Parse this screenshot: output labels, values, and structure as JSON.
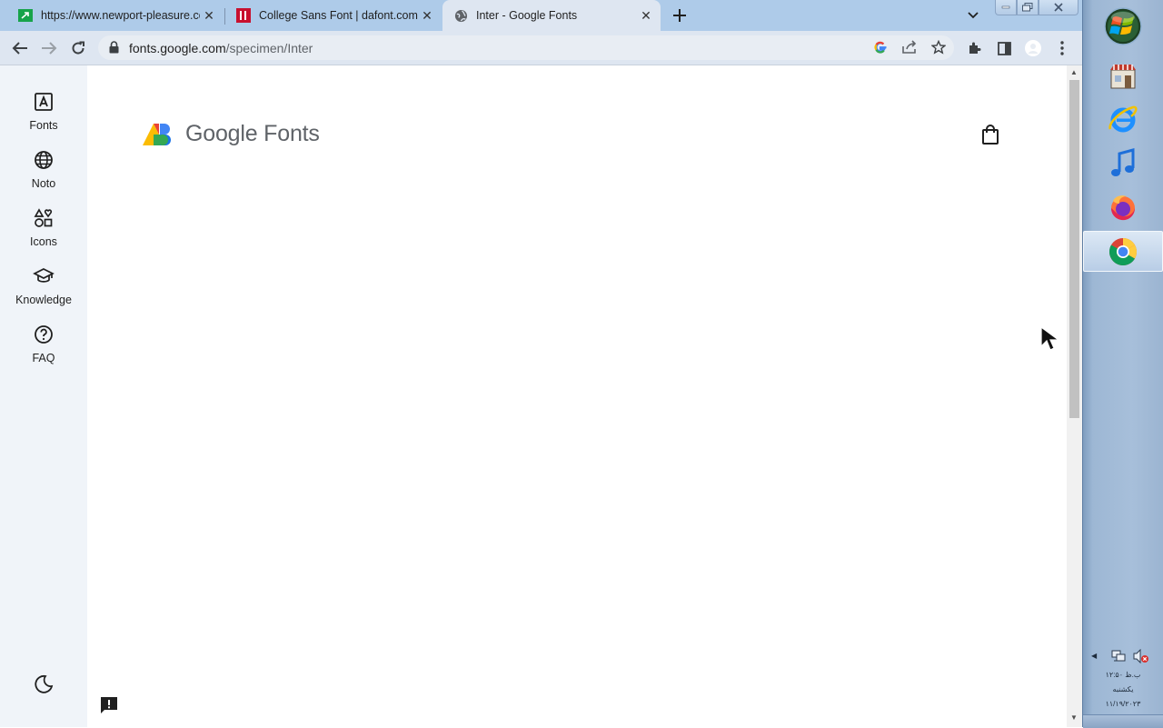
{
  "tabs": [
    {
      "title": "https://www.newport-pleasure.co",
      "favicon": "green-arrow-icon",
      "active": false
    },
    {
      "title": "College Sans Font | dafont.com",
      "favicon": "dafont-icon",
      "active": false
    },
    {
      "title": "Inter - Google Fonts",
      "favicon": "globe-icon",
      "active": true
    }
  ],
  "address_bar": {
    "host": "fonts.google.com",
    "path": "/specimen/Inter"
  },
  "rail": {
    "items": [
      {
        "label": "Fonts",
        "icon": "font-icon"
      },
      {
        "label": "Noto",
        "icon": "globe-icon"
      },
      {
        "label": "Icons",
        "icon": "shapes-icon"
      },
      {
        "label": "Knowledge",
        "icon": "graduation-cap-icon"
      },
      {
        "label": "FAQ",
        "icon": "help-icon"
      }
    ]
  },
  "header": {
    "brand": "Google",
    "product": "Fonts"
  },
  "tray": {
    "time": "۱۲:۵۰ ب.ظ",
    "day": "یکشنبه",
    "date": "۱۱/۱۹/۲۰۲۳"
  },
  "colors": {
    "tabbar": "#aecbe9",
    "toolbar": "#dee6f1",
    "rail": "#f0f4f9",
    "logo_blue": "#4285f4",
    "logo_red": "#ea4335",
    "logo_yellow": "#fbbc04",
    "logo_green": "#34a853"
  }
}
